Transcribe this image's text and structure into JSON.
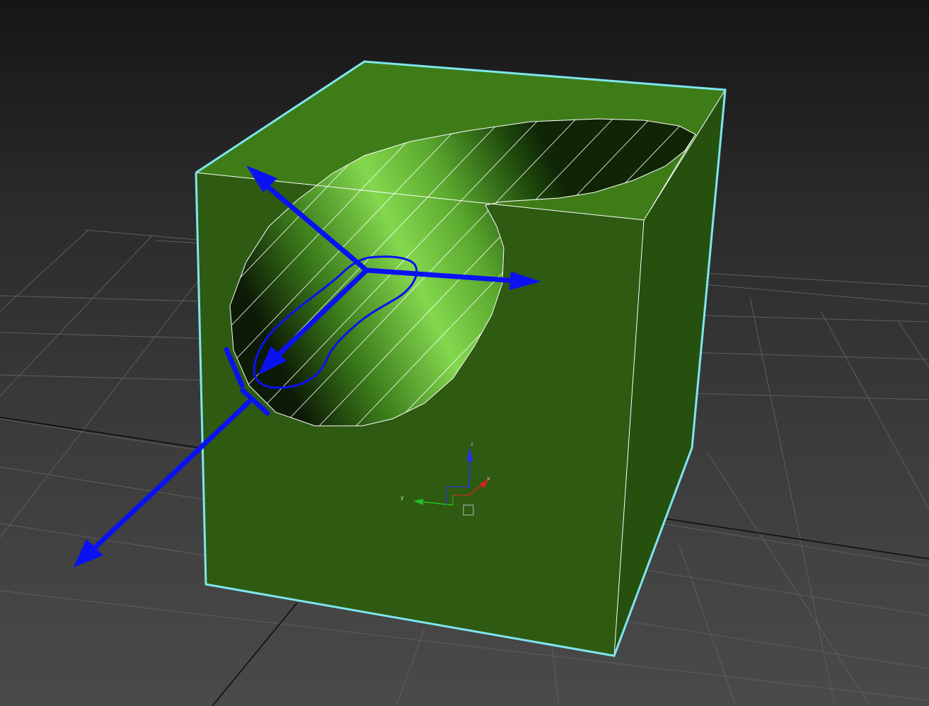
{
  "viewport": {
    "background_top": "#161616",
    "background_bottom": "#4a4a4a",
    "grid_color": "#5e5e5e",
    "grid_axis_color": "#0c0c0c"
  },
  "object": {
    "selection_outline_color": "#7fe6f0",
    "face_front_color": "#2e5a12",
    "face_right_color": "#26500e",
    "face_top_color": "#3e7c18",
    "wire_color": "#ffffff",
    "hole_highlight_color": "#84d84e"
  },
  "annotation": {
    "color": "#0b12f2",
    "arrows": [
      "arrow-up-left",
      "arrow-right",
      "arrow-down-left-inner",
      "arrow-down-left-outer"
    ]
  },
  "transform_gizmo": {
    "axis_z_label": "z",
    "axis_x_label": "x",
    "axis_y_label": "y",
    "z_color": "#2030ff",
    "x_color": "#e02020",
    "y_color": "#22c022"
  }
}
